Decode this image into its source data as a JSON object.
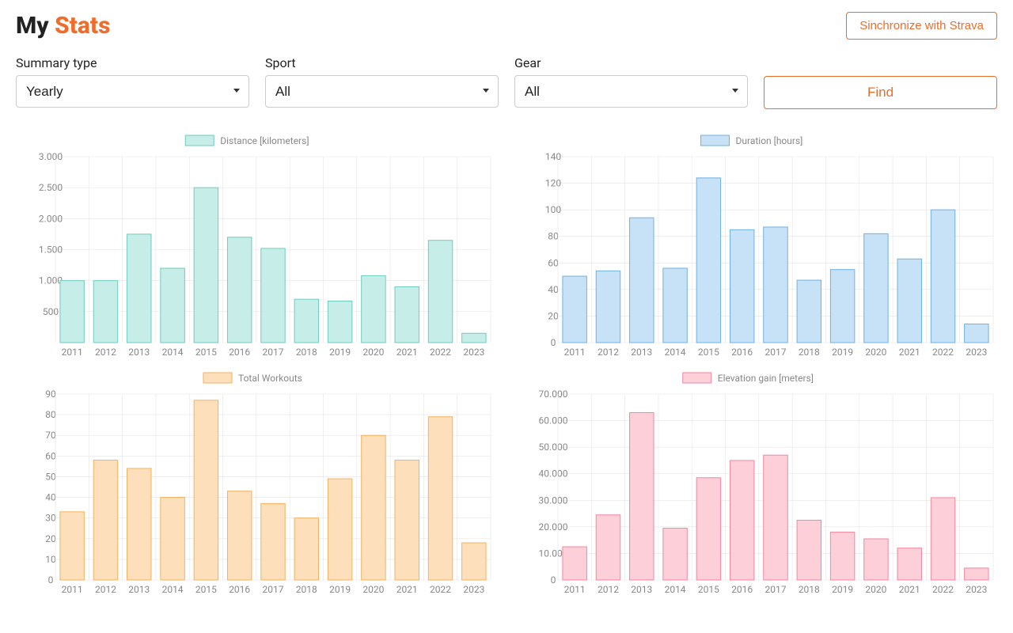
{
  "header": {
    "title_my": "My ",
    "title_stats": "Stats",
    "sync_button": "Sinchronize with Strava"
  },
  "filters": {
    "summary_type": {
      "label": "Summary type",
      "value": "Yearly"
    },
    "sport": {
      "label": "Sport",
      "value": "All"
    },
    "gear": {
      "label": "Gear",
      "value": "All"
    },
    "find_button": "Find"
  },
  "chart_data": [
    {
      "id": "distance",
      "type": "bar",
      "title": "Distance [kilometers]",
      "categories": [
        "2011",
        "2012",
        "2013",
        "2014",
        "2015",
        "2016",
        "2017",
        "2018",
        "2019",
        "2020",
        "2021",
        "2022",
        "2023"
      ],
      "values": [
        1000,
        1000,
        1750,
        1200,
        2500,
        1700,
        1520,
        700,
        670,
        1080,
        900,
        1650,
        150
      ],
      "ylim": [
        0,
        3000
      ],
      "yticks": [
        500,
        1000,
        1500,
        2000,
        2500,
        3000
      ],
      "ytick_labels": [
        "500",
        "1.000",
        "1.500",
        "2.000",
        "2.500",
        "3.000"
      ],
      "fill": "#c6ede7",
      "stroke": "#6fccc0"
    },
    {
      "id": "duration",
      "type": "bar",
      "title": "Duration [hours]",
      "categories": [
        "2011",
        "2012",
        "2013",
        "2014",
        "2015",
        "2016",
        "2017",
        "2018",
        "2019",
        "2020",
        "2021",
        "2022",
        "2023"
      ],
      "values": [
        50,
        54,
        94,
        56,
        124,
        85,
        87,
        47,
        55,
        82,
        63,
        100,
        14
      ],
      "ylim": [
        0,
        140
      ],
      "yticks": [
        0,
        20,
        40,
        60,
        80,
        100,
        120,
        140
      ],
      "ytick_labels": [
        "0",
        "20",
        "40",
        "60",
        "80",
        "100",
        "120",
        "140"
      ],
      "fill": "#c7e2f6",
      "stroke": "#6eb1e5"
    },
    {
      "id": "workouts",
      "type": "bar",
      "title": "Total Workouts",
      "categories": [
        "2011",
        "2012",
        "2013",
        "2014",
        "2015",
        "2016",
        "2017",
        "2018",
        "2019",
        "2020",
        "2021",
        "2022",
        "2023"
      ],
      "values": [
        33,
        58,
        54,
        40,
        87,
        43,
        37,
        30,
        49,
        70,
        58,
        79,
        18
      ],
      "ylim": [
        0,
        90
      ],
      "yticks": [
        0,
        10,
        20,
        30,
        40,
        50,
        60,
        70,
        80,
        90
      ],
      "ytick_labels": [
        "0",
        "10",
        "20",
        "30",
        "40",
        "50",
        "60",
        "70",
        "80",
        "90"
      ],
      "fill": "#fddfbb",
      "stroke": "#f5b15f"
    },
    {
      "id": "elevation",
      "type": "bar",
      "title": "Elevation gain [meters]",
      "categories": [
        "2011",
        "2012",
        "2013",
        "2014",
        "2015",
        "2016",
        "2017",
        "2018",
        "2019",
        "2020",
        "2021",
        "2022",
        "2023"
      ],
      "values": [
        12500,
        24500,
        63000,
        19500,
        38500,
        45000,
        47000,
        22500,
        18000,
        15500,
        12000,
        31000,
        4500
      ],
      "ylim": [
        0,
        70000
      ],
      "yticks": [
        0,
        10000,
        20000,
        30000,
        40000,
        50000,
        60000,
        70000
      ],
      "ytick_labels": [
        "0",
        "10.000",
        "20.000",
        "30.000",
        "40.000",
        "50.000",
        "60.000",
        "70.000"
      ],
      "fill": "#fccfd9",
      "stroke": "#f586a0"
    }
  ]
}
